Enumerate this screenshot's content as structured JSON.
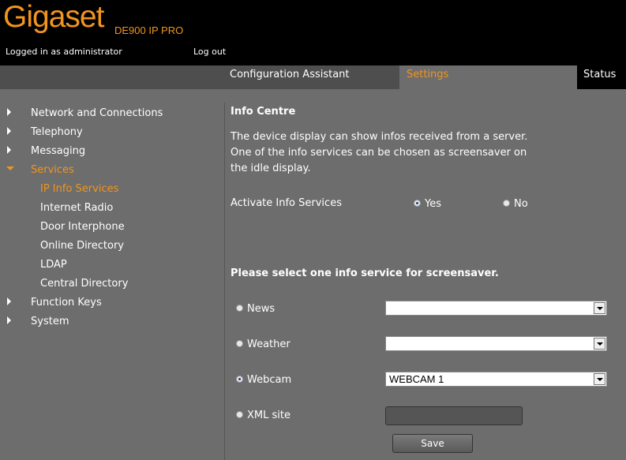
{
  "header": {
    "logo": "Gigaset",
    "product": "DE900 IP PRO",
    "logged_in": "Logged in as administrator",
    "logout": "Log out"
  },
  "tabs": {
    "config": "Configuration Assistant",
    "settings": "Settings",
    "status": "Status"
  },
  "sidebar": {
    "network": "Network and Connections",
    "telephony": "Telephony",
    "messaging": "Messaging",
    "services": "Services",
    "sub": {
      "ip_info": "IP Info Services",
      "radio": "Internet Radio",
      "door": "Door Interphone",
      "online_dir": "Online Directory",
      "ldap": "LDAP",
      "central_dir": "Central Directory"
    },
    "function_keys": "Function Keys",
    "system": "System"
  },
  "main": {
    "title": "Info Centre",
    "desc1": "The device display can show infos received from a server.",
    "desc2": "One of the info services can be chosen as screensaver on",
    "desc3": "the idle display.",
    "activate_label": "Activate Info Services",
    "yes": "Yes",
    "no": "No",
    "select_heading": "Please select one info service for screensaver.",
    "news": "News",
    "weather": "Weather",
    "webcam": "Webcam",
    "webcam_value": "WEBCAM 1",
    "xml": "XML site",
    "save": "Save"
  }
}
